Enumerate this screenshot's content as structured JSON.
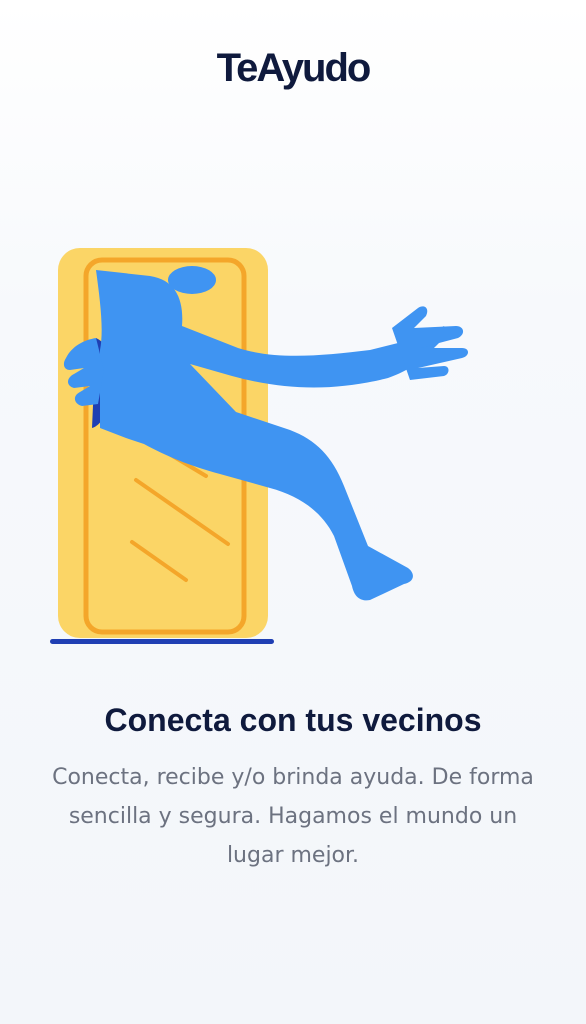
{
  "app": {
    "brand": "TeAyudo"
  },
  "onboarding": {
    "illustration_icon": "person-stepping-through-door-illustration",
    "headline": "Conecta con tus vecinos",
    "body": "Conecta, recibe y/o brinda ayuda. De forma sencilla y segura. Hagamos el mundo un lugar mejor."
  },
  "colors": {
    "brand_text": "#0f1a3d",
    "body_text": "#6c7280",
    "door_fill": "#fbd566",
    "door_stroke": "#f4a62a",
    "figure": "#3f94f2",
    "figure_dark": "#1f3fb3"
  }
}
